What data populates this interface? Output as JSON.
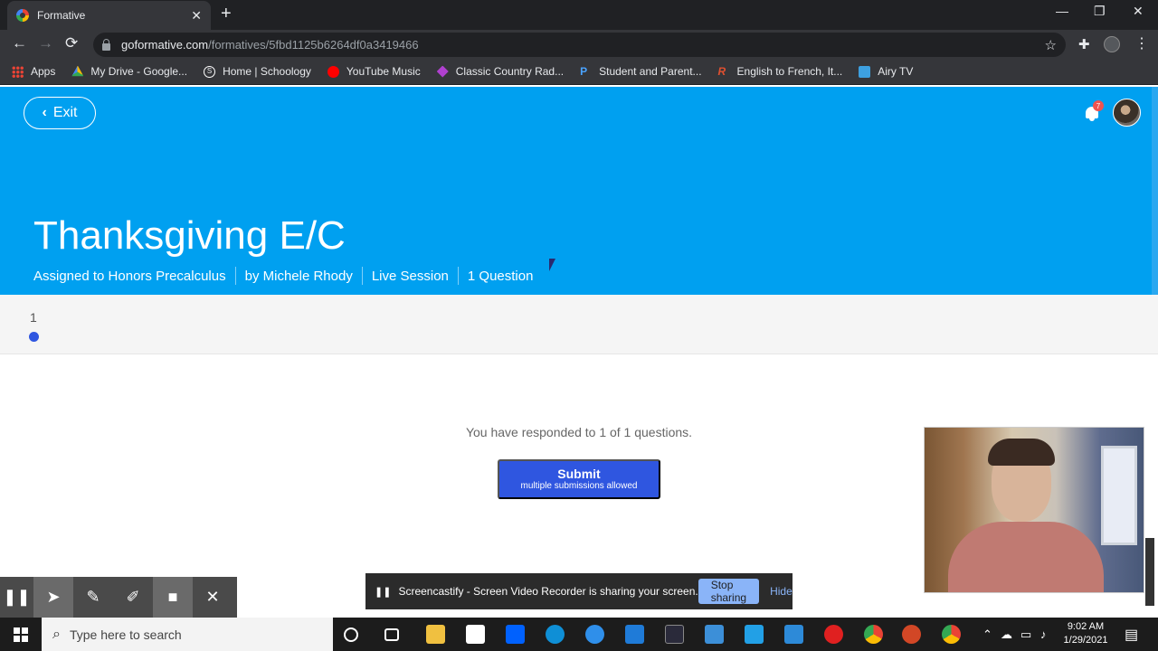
{
  "browser": {
    "tab_title": "Formative",
    "tab_close": "✕",
    "new_tab": "+",
    "url_host": "goformative.com",
    "url_path": "/formatives/5fbd1125b6264df0a3419466",
    "window_controls": {
      "minimize": "—",
      "maximize": "❐",
      "close": "✕"
    },
    "nav": {
      "back": "←",
      "forward": "→",
      "reload": "⟳"
    },
    "bookmarks": [
      {
        "label": "Apps",
        "icon": "apps-icon",
        "color": "#4285f4"
      },
      {
        "label": "My Drive - Google...",
        "icon": "google-drive-icon",
        "color": "#fbbc05"
      },
      {
        "label": "Home | Schoology",
        "icon": "schoology-icon",
        "color": "#ffffff"
      },
      {
        "label": "YouTube Music",
        "icon": "youtube-music-icon",
        "color": "#ff0000"
      },
      {
        "label": "Classic Country Rad...",
        "icon": "radio-icon",
        "color": "#b040d0"
      },
      {
        "label": "Student and Parent...",
        "icon": "powerschool-icon",
        "color": "#4aa3ff"
      },
      {
        "label": "English to French, It...",
        "icon": "reverso-icon",
        "color": "#e05030"
      },
      {
        "label": "Airy TV",
        "icon": "airy-tv-icon",
        "color": "#3da0e0"
      }
    ]
  },
  "header": {
    "exit_label": "Exit",
    "notification_count": "7",
    "title": "Thanksgiving E/C",
    "meta": {
      "assigned": "Assigned to Honors Precalculus",
      "author": "by Michele Rhody",
      "session": "Live Session",
      "questions": "1 Question"
    },
    "color": "#00a0f0"
  },
  "question_nav": {
    "number": "1"
  },
  "main": {
    "responded_text": "You have responded to 1 of 1 questions.",
    "submit_label": "Submit",
    "submit_sub": "multiple submissions allowed",
    "accent": "#2f56e0"
  },
  "screencastify": {
    "share_text": "Screencastify - Screen Video Recorder is sharing your screen.",
    "stop_label": "Stop sharing",
    "hide_label": "Hide"
  },
  "taskbar": {
    "search_placeholder": "Type here to search",
    "time": "9:02 AM",
    "date": "1/29/2021"
  }
}
